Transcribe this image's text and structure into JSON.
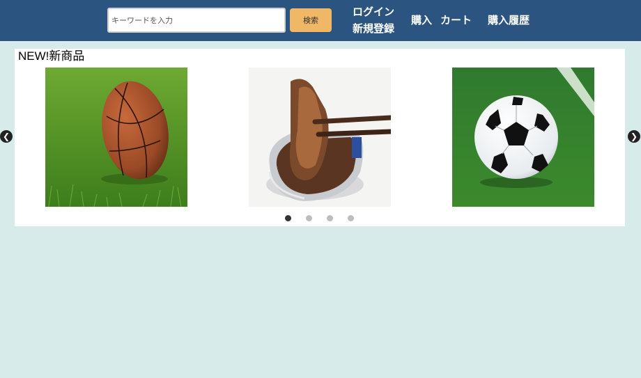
{
  "header": {
    "search": {
      "placeholder": "キーワードを入力",
      "value": ""
    },
    "search_button_label": "検索",
    "nav": {
      "login": "ログイン",
      "signup": "新規登録",
      "purchase": "購入",
      "cart": "カート",
      "history": "購入履歴"
    }
  },
  "main": {
    "section_title": "NEW!新商品",
    "products": [
      {
        "image": "basketball-on-grass"
      },
      {
        "image": "canned-fish-with-chopsticks"
      },
      {
        "image": "soccer-ball-on-grass"
      }
    ],
    "carousel": {
      "prev_icon": "chevron-left-icon",
      "next_icon": "chevron-right-icon",
      "dot_count": 4,
      "active_dot": 1
    }
  },
  "colors": {
    "header_bg": "#2b5480",
    "page_bg": "#d7ecea",
    "search_button": "#f0b866",
    "panel_bg": "#ffffff"
  }
}
